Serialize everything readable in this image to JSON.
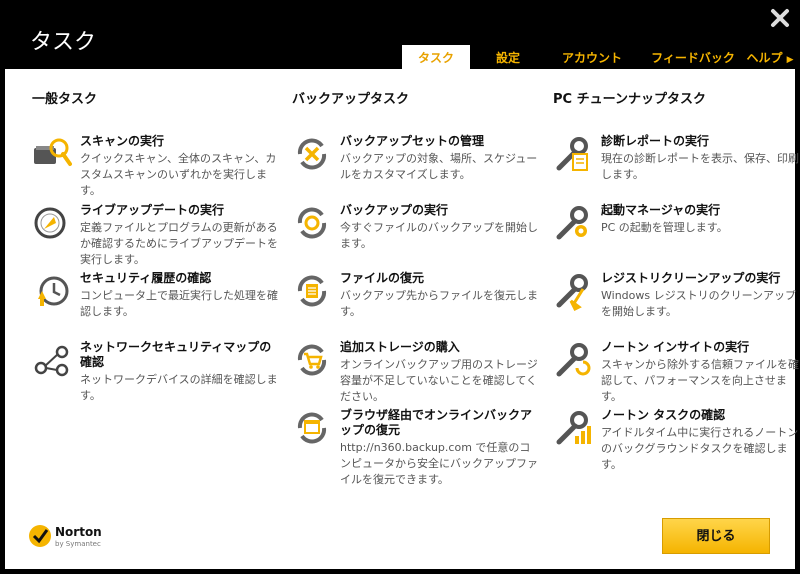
{
  "window": {
    "title": "タスク"
  },
  "tabs": [
    {
      "label": "タスク"
    },
    {
      "label": "設定"
    },
    {
      "label": "アカウント"
    },
    {
      "label": "フィードバック"
    },
    {
      "label": "ヘルプ"
    }
  ],
  "columns": [
    {
      "header": "一般タスク",
      "items": [
        {
          "title": "スキャンの実行",
          "desc": "クイックスキャン、全体のスキャン、カスタムスキャンのいずれかを実行します。"
        },
        {
          "title": "ライブアップデートの実行",
          "desc": "定義ファイルとプログラムの更新があるか確認するためにライブアップデートを実行します。"
        },
        {
          "title": "セキュリティ履歴の確認",
          "desc": "コンピュータ上で最近実行した処理を確認します。"
        },
        {
          "title": "ネットワークセキュリティマップの確認",
          "desc": "ネットワークデバイスの詳細を確認します。"
        }
      ]
    },
    {
      "header": "バックアップタスク",
      "items": [
        {
          "title": "バックアップセットの管理",
          "desc": "バックアップの対象、場所、スケジュールをカスタマイズします。"
        },
        {
          "title": "バックアップの実行",
          "desc": "今すぐファイルのバックアップを開始します。"
        },
        {
          "title": "ファイルの復元",
          "desc": "バックアップ先からファイルを復元します。"
        },
        {
          "title": "追加ストレージの購入",
          "desc": "オンラインバックアップ用のストレージ容量が不足していないことを確認してください。"
        },
        {
          "title": "ブラウザ経由でオンラインバックアップの復元",
          "desc": "http://n360.backup.com で任意のコンピュータから安全にバックアップファイルを復元できます。"
        }
      ]
    },
    {
      "header": "PC チューンナップタスク",
      "items": [
        {
          "title": "診断レポートの実行",
          "desc": "現在の診断レポートを表示、保存、印刷します。"
        },
        {
          "title": "起動マネージャの実行",
          "desc": "PC の起動を管理します。"
        },
        {
          "title": "レジストリクリーンアップの実行",
          "desc": "Windows レジストリのクリーンアップを開始します。"
        },
        {
          "title": "ノートン インサイトの実行",
          "desc": "スキャンから除外する信頼ファイルを確認して、パフォーマンスを向上させます。"
        },
        {
          "title": "ノートン タスクの確認",
          "desc": "アイドルタイム中に実行されるノートンのバックグラウンドタスクを確認します。"
        }
      ]
    }
  ],
  "footer": {
    "brand": "Norton",
    "brand_sub": "by Symantec",
    "close_label": "閉じる"
  },
  "colors": {
    "accent": "#f5b400",
    "background": "#000000",
    "panel": "#ffffff"
  }
}
